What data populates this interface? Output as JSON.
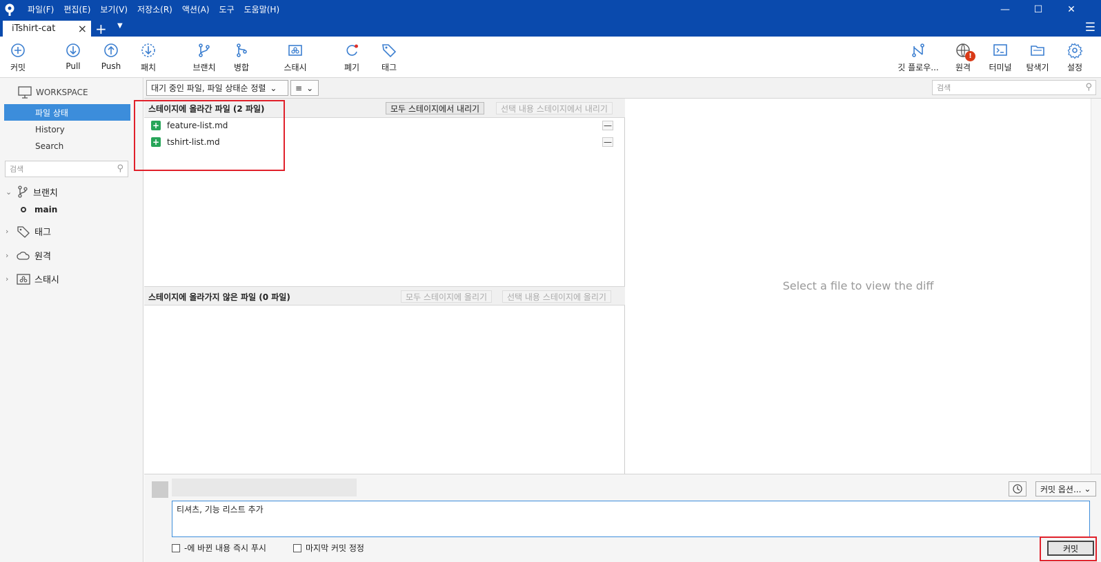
{
  "titlebar": {
    "menu": [
      "파일(F)",
      "편집(E)",
      "보기(V)",
      "저장소(R)",
      "액션(A)",
      "도구",
      "도움말(H)"
    ]
  },
  "tabs": {
    "active_tab": "iTshirt-cat"
  },
  "toolbar": {
    "commit": "커밋",
    "pull": "Pull",
    "push": "Push",
    "patch": "패치",
    "branch": "브랜치",
    "merge": "병합",
    "stash": "스태시",
    "discard": "폐기",
    "tag": "태그",
    "gitflow": "깃 플로우...",
    "remote": "원격",
    "remote_badge": "!",
    "terminal": "터미널",
    "explorer": "탐색기",
    "settings": "설정"
  },
  "sidebar": {
    "workspace": "WORKSPACE",
    "items": [
      "파일 상태",
      "History",
      "Search"
    ],
    "search_placeholder": "검색",
    "branches": "브랜치",
    "branch_main": "main",
    "tags": "태그",
    "remotes": "원격",
    "stashes": "스태시"
  },
  "filterbar": {
    "sort_select": "대기 중인 파일, 파일 상태순 정렬",
    "view_icon": "≡",
    "search_placeholder": "검색"
  },
  "staged": {
    "title": "스테이지에 올라간 파일  (2 파일)",
    "unstage_all": "모두 스테이지에서 내리기",
    "unstage_selected": "선택 내용 스테이지에서 내리기",
    "files": [
      "feature-list.md",
      "tshirt-list.md"
    ]
  },
  "unstaged": {
    "title": "스테이지에 올라가지 않은 파일  (0 파일)",
    "stage_all": "모두 스테이지에 올리기",
    "stage_selected": "선택 내용 스테이지에 올리기"
  },
  "diff": {
    "placeholder": "Select a file to view the diff"
  },
  "commit": {
    "message": "티셔츠, 기능 리스트 추가",
    "options": "커밋 옵션...",
    "push_immediately": "-에 바뀐 내용 즉시 푸시",
    "amend": "마지막 커밋 정정",
    "button": "커밋"
  }
}
